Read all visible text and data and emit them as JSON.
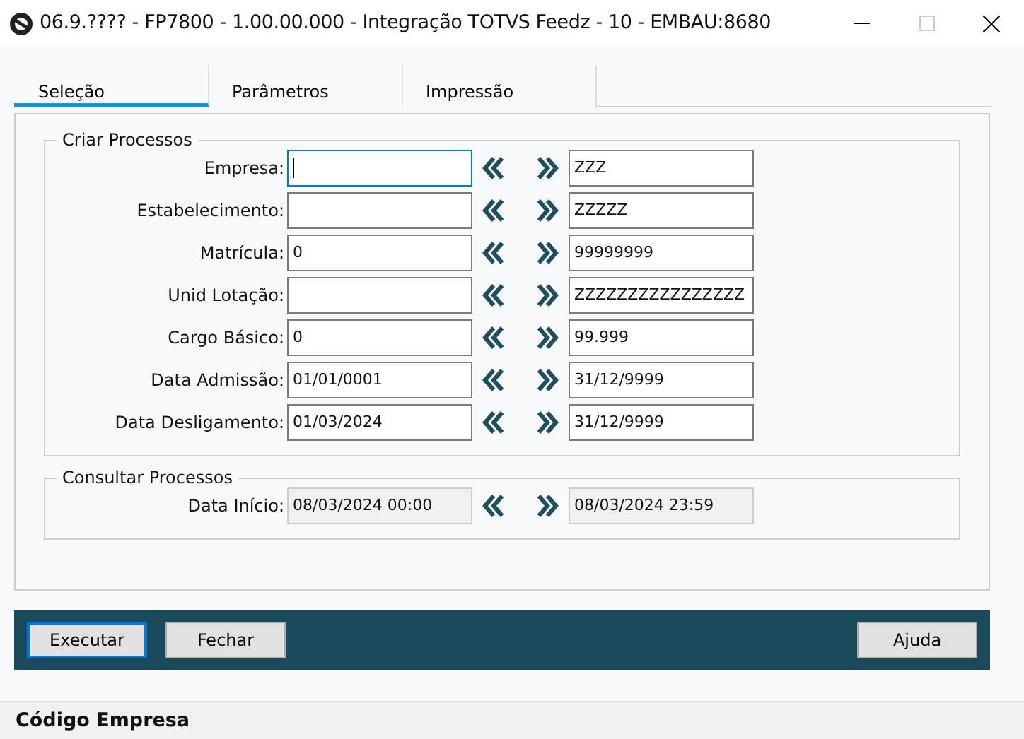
{
  "window": {
    "title": "06.9.???? - FP7800 - 1.00.00.000 - Integração TOTVS Feedz - 10 - EMBAU:8680"
  },
  "tabs": [
    {
      "label": "Seleção",
      "selected": true
    },
    {
      "label": "Parâmetros",
      "selected": false
    },
    {
      "label": "Impressão",
      "selected": false
    }
  ],
  "groups": [
    {
      "title": "Criar Processos",
      "rows": [
        {
          "label": "Empresa:",
          "from": "",
          "to": "ZZZ",
          "focused": true,
          "disabled": false
        },
        {
          "label": "Estabelecimento:",
          "from": "",
          "to": "ZZZZZ",
          "focused": false,
          "disabled": false
        },
        {
          "label": "Matrícula:",
          "from": "0",
          "to": "99999999",
          "focused": false,
          "disabled": false
        },
        {
          "label": "Unid Lotação:",
          "from": "",
          "to": "ZZZZZZZZZZZZZZZZ",
          "focused": false,
          "disabled": false
        },
        {
          "label": "Cargo Básico:",
          "from": "0",
          "to": "99.999",
          "focused": false,
          "disabled": false
        },
        {
          "label": "Data Admissão:",
          "from": "01/01/0001",
          "to": "31/12/9999",
          "focused": false,
          "disabled": false
        },
        {
          "label": "Data Desligamento:",
          "from": "01/03/2024",
          "to": "31/12/9999",
          "focused": false,
          "disabled": false
        }
      ]
    },
    {
      "title": "Consultar Processos",
      "rows": [
        {
          "label": "Data Início:",
          "from": "08/03/2024 00:00",
          "to": "08/03/2024 23:59",
          "focused": false,
          "disabled": true
        }
      ]
    }
  ],
  "buttons": [
    {
      "label": "Executar",
      "focused": true
    },
    {
      "label": "Fechar",
      "focused": false
    }
  ],
  "right_buttons": [
    {
      "label": "Ajuda",
      "focused": false
    }
  ],
  "status_bar": "Código Empresa"
}
